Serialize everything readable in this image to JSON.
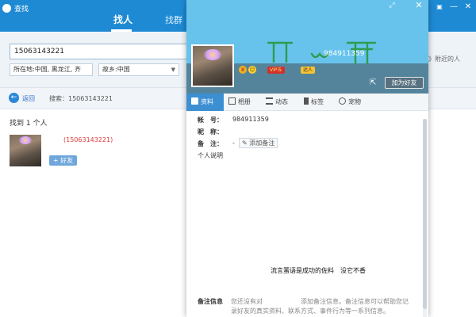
{
  "find_window": {
    "title": "查找",
    "tabs": [
      {
        "label": "找人"
      },
      {
        "label": "找群"
      }
    ],
    "controls": {
      "minimize": "—",
      "close": "✕"
    },
    "search_value": "15063143221",
    "location_value": "所在地:中国, 黑龙江, 齐",
    "hometown_value": "故乡:中国",
    "nearby_text": "》附近的人",
    "back_label": "返回",
    "search_status": "搜索：15063143221",
    "found_count": "找到 1 个人",
    "result": {
      "name": "(15063143221)",
      "add_label": "+ 好友"
    }
  },
  "profile_card": {
    "controls": {
      "expand": "⤢",
      "close": "✕"
    },
    "qq_number": "984911359",
    "badges": {
      "vip": "VIP五",
      "member": "达人"
    },
    "add_friend_label": "加为好友",
    "tabs": [
      {
        "label": "资料",
        "icon": "profile-icon"
      },
      {
        "label": "相册",
        "icon": "album-icon"
      },
      {
        "label": "动态",
        "icon": "feed-icon"
      },
      {
        "label": "标签",
        "icon": "tag-icon"
      },
      {
        "label": "宠物",
        "icon": "pet-icon"
      }
    ],
    "fields": {
      "account_label": "帐　号：",
      "account_value": "984911359",
      "nickname_label": "昵　称：",
      "remark_label": "备　注：",
      "remark_dash": "-",
      "remark_add": "添加备注",
      "bio_label": "个人说明"
    },
    "signature": "流言蜚语是成功的佐料　没它不香",
    "note_label": "备注信息",
    "note_text": "您还没有对　　　　　　添加备注信息。备注信息可以帮助您记录好友的真实资料、联系方式、事件行为等一系列信息。"
  },
  "colors": {
    "title_blue": "#1e8ad4",
    "banner_sky": "#67c3ec",
    "tab_active": "#3d8fd3",
    "result_name": "#e13b3b"
  }
}
